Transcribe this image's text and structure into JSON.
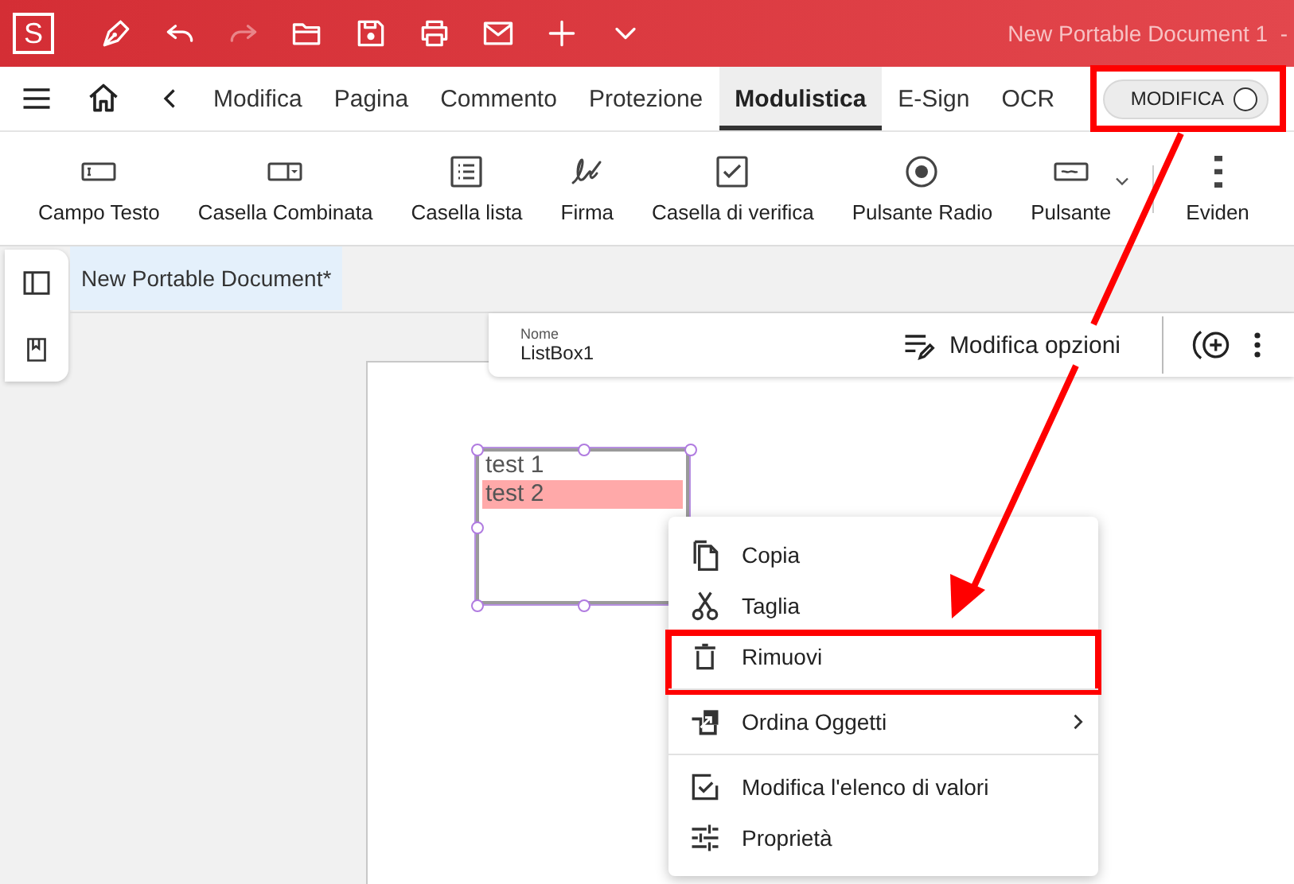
{
  "title_bar": {
    "logo": "S",
    "document_title": "New Portable Document 1  -"
  },
  "tabs": [
    {
      "label": "Modifica",
      "selected": false
    },
    {
      "label": "Pagina",
      "selected": false
    },
    {
      "label": "Commento",
      "selected": false
    },
    {
      "label": "Protezione",
      "selected": false
    },
    {
      "label": "Modulistica",
      "selected": true
    },
    {
      "label": "E-Sign",
      "selected": false
    },
    {
      "label": "OCR",
      "selected": false
    }
  ],
  "mode_toggle": {
    "label": "MODIFICA",
    "on": false,
    "callout": true
  },
  "ribbon": {
    "tools": [
      {
        "label": "Campo Testo",
        "dropdown": false
      },
      {
        "label": "Casella Combinata",
        "dropdown": false
      },
      {
        "label": "Casella lista",
        "dropdown": false
      },
      {
        "label": "Firma",
        "dropdown": false
      },
      {
        "label": "Casella di verifica",
        "dropdown": false
      },
      {
        "label": "Pulsante Radio",
        "dropdown": false
      },
      {
        "label": "Pulsante",
        "dropdown": true
      },
      {
        "label": "Eviden",
        "dropdown": false
      }
    ]
  },
  "document_tabs": [
    {
      "label": "New Portable Document*",
      "selected": true
    }
  ],
  "field_toolbar": {
    "name_label": "Nome",
    "name_value": "ListBox1",
    "edit_options": "Modifica opzioni"
  },
  "listbox": {
    "items": [
      {
        "text": "test 1",
        "selected": false
      },
      {
        "text": "test 2",
        "selected": true
      }
    ]
  },
  "context_menu": {
    "items": [
      {
        "label": "Copia",
        "divider_before": false,
        "submenu": false,
        "callout": false
      },
      {
        "label": "Taglia",
        "divider_before": false,
        "submenu": false,
        "callout": false
      },
      {
        "label": "Rimuovi",
        "divider_before": false,
        "submenu": false,
        "callout": true
      },
      {
        "label": "Ordina Oggetti",
        "divider_before": true,
        "submenu": true,
        "callout": false
      },
      {
        "label": "Modifica l'elenco di valori",
        "divider_before": true,
        "submenu": false,
        "callout": false
      },
      {
        "label": "Proprietà",
        "divider_before": false,
        "submenu": false,
        "callout": false
      }
    ]
  }
}
